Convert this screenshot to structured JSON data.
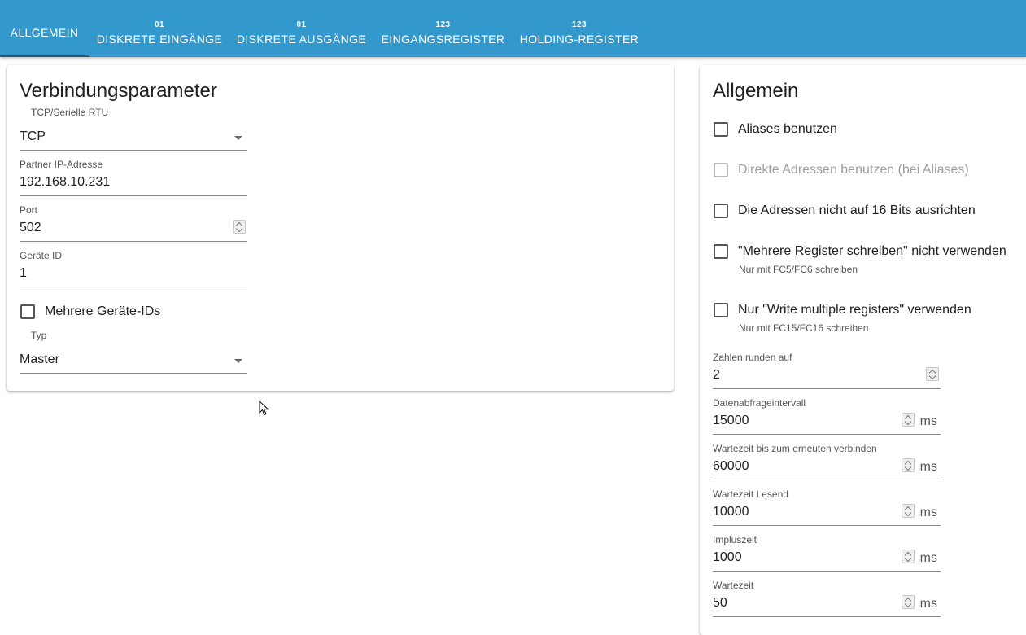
{
  "tabs": [
    {
      "badge": "",
      "label": "ALLGEMEIN"
    },
    {
      "badge": "01",
      "label": "DISKRETE EINGÄNGE"
    },
    {
      "badge": "01",
      "label": "DISKRETE AUSGÄNGE"
    },
    {
      "badge": "123",
      "label": "EINGANGSREGISTER"
    },
    {
      "badge": "123",
      "label": "HOLDING-REGISTER"
    }
  ],
  "connection": {
    "title": "Verbindungsparameter",
    "protocol_label": "TCP/Serielle RTU",
    "protocol_value": "TCP",
    "ip_label": "Partner IP-Adresse",
    "ip_value": "192.168.10.231",
    "port_label": "Port",
    "port_value": "502",
    "device_id_label": "Geräte ID",
    "device_id_value": "1",
    "multi_ids_label": "Mehrere Geräte-IDs",
    "type_label": "Typ",
    "type_value": "Master"
  },
  "general": {
    "title": "Allgemein",
    "use_aliases": "Aliases benutzen",
    "direct_addresses": "Direkte Adressen benutzen (bei Aliases)",
    "no_align": "Die Adressen nicht auf 16 Bits ausrichten",
    "no_multi_write": "\"Mehrere Register schreiben\" nicht verwenden",
    "no_multi_write_hint": "Nur mit FC5/FC6 schreiben",
    "only_multi_write": "Nur \"Write multiple registers\" verwenden",
    "only_multi_write_hint": "Nur mit FC15/FC16 schreiben",
    "round_label": "Zahlen runden auf",
    "round_value": "2",
    "poll_label": "Datenabfrageintervall",
    "poll_value": "15000",
    "reconnect_label": "Wartezeit bis zum erneuten verbinden",
    "reconnect_value": "60000",
    "read_timeout_label": "Wartezeit Lesend",
    "read_timeout_value": "10000",
    "pulse_label": "Impluszeit",
    "pulse_value": "1000",
    "wait_label": "Wartezeit",
    "wait_value": "50",
    "unit": "ms"
  }
}
